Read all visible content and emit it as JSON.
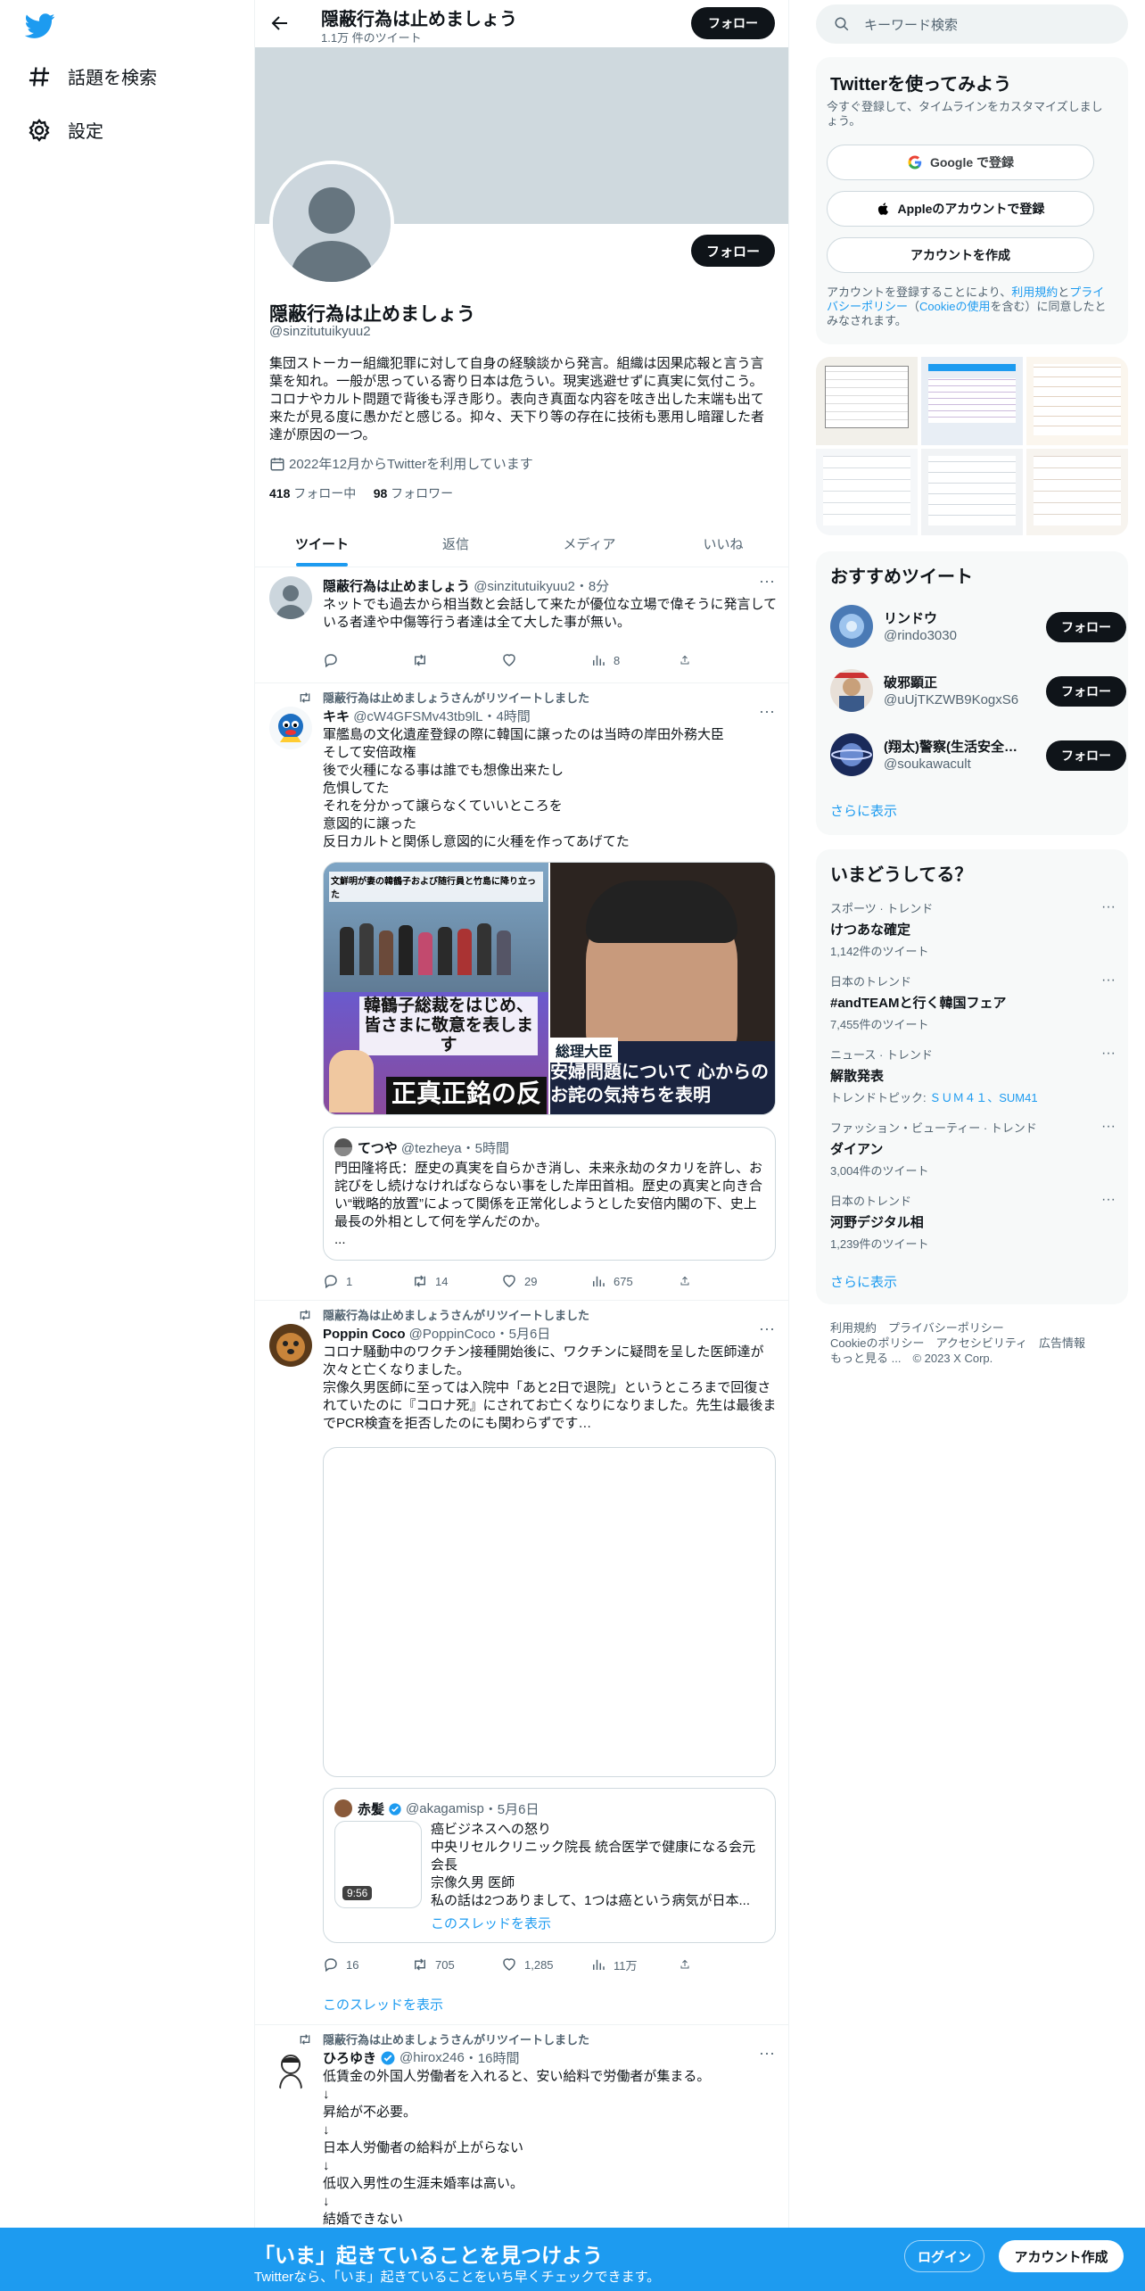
{
  "nav": {
    "explore_label": "話題を検索",
    "settings_label": "設定"
  },
  "profile": {
    "name": "隠蔽行為は止めましょう",
    "tweet_count": "1.1万 件のツイート",
    "follow_label": "フォロー",
    "handle": "@sinzitutuikyuu2",
    "bio": "集団ストーカー組織犯罪に対して自身の経験談から発言。組織は因果応報と言う言葉を知れ。一般が思っている寄り日本は危うい。現実逃避せずに真実に気付こう。コロナやカルト問題で背後も浮き彫り。表向き真面な内容を呟き出した末端も出て来たが見る度に愚かだと感じる。抑々、天下り等の存在に技術も悪用し暗躍した者達が原因の一つ。",
    "joined": "2022年12月からTwitterを利用しています",
    "following_count": "418",
    "following_label": "フォロー中",
    "followers_count": "98",
    "followers_label": "フォロワー"
  },
  "tabs": [
    "ツイート",
    "返信",
    "メディア",
    "いいね"
  ],
  "tweets": [
    {
      "name": "隠蔽行為は止めましょう",
      "handle": "@sinzitutuikyuu2",
      "time": "・8分",
      "text": "ネットでも過去から相当数と会話して来たが優位な立場で偉そうに発言している者達や中傷等行う者達は全て大した事が無い。",
      "views": "8"
    },
    {
      "retweeted_by": "隠蔽行為は止めましょうさんがリツイートしました",
      "name": "キキ",
      "handle": "@cW4GFSMv43tb9lL",
      "time": "・4時間",
      "text": "軍艦島の文化遺産登録の際に韓国に譲ったのは当時の岸田外務大臣\nそして安倍政権\n後で火種になる事は誰でも想像出来たし\n危惧してた\nそれを分かって譲らなくていいところを\n意図的に譲った\n反日カルトと関係し意図的に火種を作ってあげてた",
      "image_left_caption_top": "文鮮明が妻の韓鶴子および随行員と竹島に降り立った",
      "image_left_caption_mid": "韓鶴子総裁をはじめ、皆さまに敬意を表します",
      "image_left_caption_bottom": "正真正銘の反日",
      "image_right_caption_tag": "総理大臣",
      "image_right_caption_bottom": "安婦問題について 心からのお詫の気持ちを表明",
      "quote_name": "てつや",
      "quote_handle": "@tezheya",
      "quote_time": "・5時間",
      "quote_text": "門田隆将氏：歴史の真実を自らかき消し、未来永劫のタカリを許し、お詫びをし続けなければならない事をした岸田首相。歴史の真実と向き合い“戦略的放置”によって関係を正常化しようとした安倍内閣の下、史上最長の外相として何を学んだのか。\n...",
      "replies": "1",
      "retweets": "14",
      "likes": "29",
      "views": "675"
    },
    {
      "retweeted_by": "隠蔽行為は止めましょうさんがリツイートしました",
      "name": "Poppin Coco",
      "handle": "@PoppinCoco",
      "time": "・5月6日",
      "text": "コロナ騒動中のワクチン接種開始後に、ワクチンに疑問を呈した医師達が次々と亡くなりました。\n宗像久男医師に至っては入院中「あと2日で退院」というところまで回復されていたのに『コロナ死』にされてお亡くなりになりました。先生は最後までPCR検査を拒否したのにも関わらずです…",
      "quote_name": "赤髪",
      "quote_handle": "@akagamisp",
      "quote_time": "・5月6日",
      "quote_text": "癌ビジネスへの怒り\n中央リセルクリニック院長 統合医学で健康になる会元会長\n宗像久男 医師\n私の話は2つありまして、1つは癌という病気が日本...",
      "quote_duration": "9:56",
      "quote_show_thread": "このスレッドを表示",
      "replies": "16",
      "retweets": "705",
      "likes": "1,285",
      "views": "11万",
      "show_thread": "このスレッドを表示"
    },
    {
      "retweeted_by": "隠蔽行為は止めましょうさんがリツイートしました",
      "name": "ひろゆき",
      "handle": "@hirox246",
      "time": "・16時間",
      "text": "低賃金の外国人労働者を入れると、安い給料で労働者が集まる。\n↓\n昇給が不必要。\n↓\n日本人労働者の給料が上がらない\n↓\n低収入男性の生涯未婚率は高い。\n↓\n結婚できない"
    }
  ],
  "right": {
    "search_placeholder": "キーワード検索",
    "signup_title": "Twitterを使ってみよう",
    "signup_sub": "今すぐ登録して、タイムラインをカスタマイズしましょう。",
    "google_btn": "Google で登録",
    "apple_btn": "Appleのアカウントで登録",
    "create_btn": "アカウントを作成",
    "terms_pre": "アカウントを登録することにより、",
    "terms_link1": "利用規約",
    "terms_and": "と",
    "terms_link2": "プライバシーポリシー",
    "terms_paren_open": "（",
    "terms_link3": "Cookieの使用",
    "terms_post": "を含む）に同意したとみなされます。",
    "rec_title": "おすすめツイート",
    "recs": [
      {
        "name": "リンドウ",
        "handle": "@rindo3030"
      },
      {
        "name": "破邪顕正",
        "handle": "@uUjTKZWB9KogxS6"
      },
      {
        "name": "(翔太)警察(生活安全…",
        "handle": "@soukawacult"
      }
    ],
    "rec_follow": "フォロー",
    "more": "さらに表示",
    "trends_title": "いまどうしてる？",
    "trends": [
      {
        "cat": "スポーツ · トレンド",
        "title": "けつあな確定",
        "count": "1,142件のツイート"
      },
      {
        "cat": "日本のトレンド",
        "title": "#andTEAMと行く韓国フェア",
        "count": "7,455件のツイート"
      },
      {
        "cat": "ニュース · トレンド",
        "title": "解散発表",
        "count_prefix": "トレンドトピック: ",
        "count_link": "ＳＵＭ４１、SUM41"
      },
      {
        "cat": "ファッション・ビューティー · トレンド",
        "title": "ダイアン",
        "count": "3,004件のツイート"
      },
      {
        "cat": "日本のトレンド",
        "title": "河野デジタル相",
        "count": "1,239件のツイート"
      }
    ],
    "footer_line1": "利用規約　プライバシーポリシー",
    "footer_line2": "Cookieのポリシー　アクセシビリティ　広告情報",
    "footer_line3": "もっと見る ...　© 2023 X Corp."
  },
  "bottombar": {
    "title": "「いま」起きていることを見つけよう",
    "sub": "Twitterなら、「いま」起きていることをいち早くチェックできます。",
    "login": "ログイン",
    "signup": "アカウント作成"
  },
  "colors": {
    "accent": "#1d9bf0",
    "text": "#0f1419",
    "muted": "#536471",
    "banner": "#cfd9de"
  }
}
